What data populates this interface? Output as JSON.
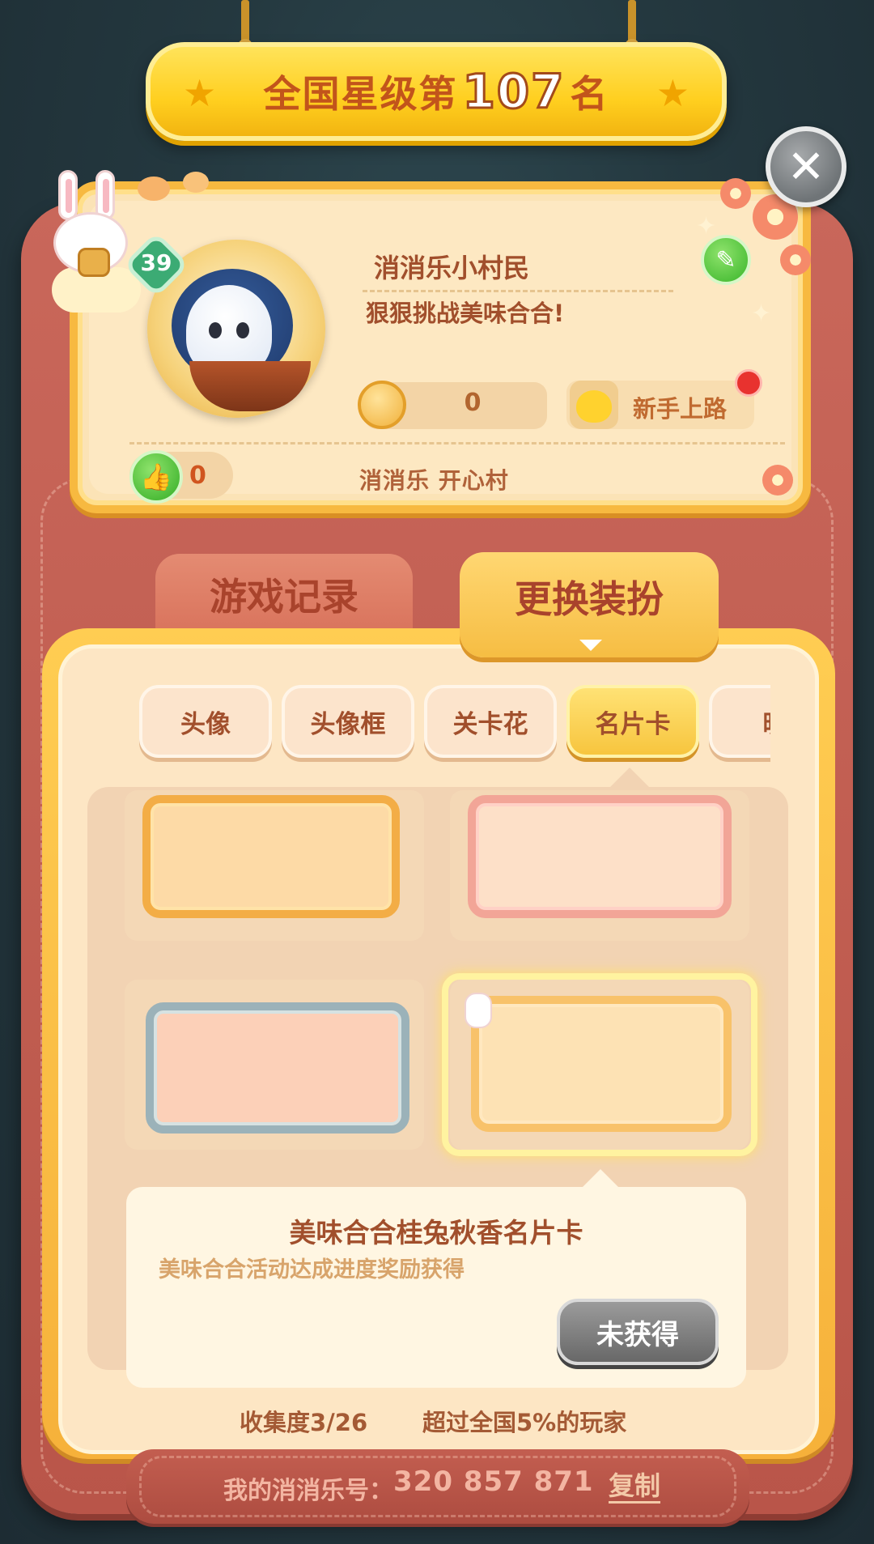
{
  "header": {
    "rank_prefix": "全国星级第",
    "rank_number": "107",
    "rank_suffix": "名"
  },
  "profile": {
    "level": "39",
    "nickname": "消消乐小村民",
    "signature": "狠狠挑战美味合合!",
    "coin_value": "0",
    "title_label": "新手上路",
    "likes": "0",
    "village": "消消乐  开心村"
  },
  "tabs": [
    {
      "label": "游戏记录",
      "active": false
    },
    {
      "label": "更换装扮",
      "active": true
    }
  ],
  "categories": [
    {
      "label": "头像",
      "active": false
    },
    {
      "label": "头像框",
      "active": false
    },
    {
      "label": "关卡花",
      "active": false
    },
    {
      "label": "名片卡",
      "active": true
    },
    {
      "label": "昵",
      "active": false
    }
  ],
  "selected_item": {
    "name": "美味合合桂兔秋香名片卡",
    "description": "美味合合活动达成进度奖励获得",
    "status_button": "未获得"
  },
  "stats": {
    "collection": "收集度3/26",
    "surpass": "超过全国5%的玩家"
  },
  "footer": {
    "account_label": "我的消消乐号：",
    "account_number": "320 857 871",
    "copy_label": "复制"
  },
  "icons": {
    "close": "close-icon",
    "edit": "pencil-icon",
    "like": "thumbs-up-icon",
    "coin": "mooncake-coin-icon",
    "chick": "chick-icon"
  },
  "colors": {
    "banner_yellow": "#ffcf1f",
    "frame_red": "#c9675a",
    "text_brown": "#a14f2c",
    "panel_gold": "#f6b13a"
  }
}
